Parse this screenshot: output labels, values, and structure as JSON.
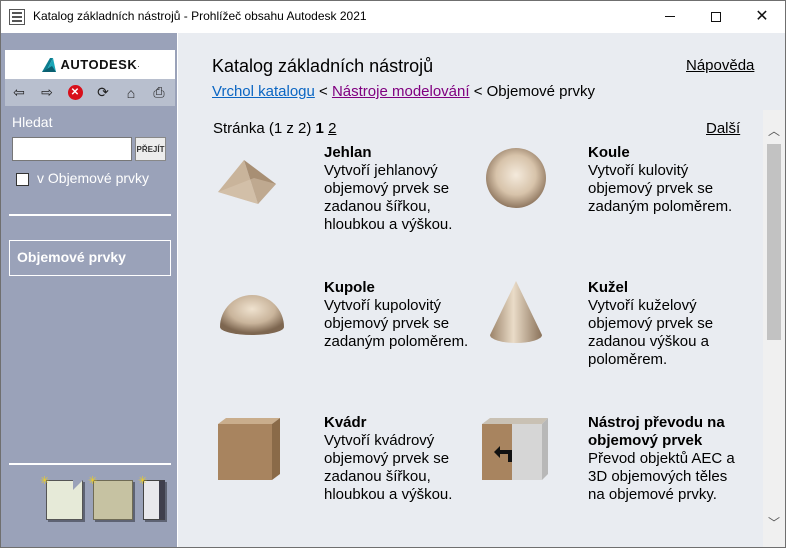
{
  "window": {
    "title": "Katalog základních nástrojů - Prohlížeč obsahu Autodesk 2021",
    "controls": {
      "minimize": "",
      "maximize": "",
      "close": "✕"
    }
  },
  "sidebar": {
    "logo_text": "AUTODESK",
    "logo_dot": ".",
    "nav_icons": [
      {
        "name": "back-icon",
        "glyph": "⇦"
      },
      {
        "name": "forward-icon",
        "glyph": "⇨"
      },
      {
        "name": "stop-icon",
        "glyph": "✕"
      },
      {
        "name": "refresh-icon",
        "glyph": "⟳"
      },
      {
        "name": "home-icon",
        "glyph": "⌂"
      },
      {
        "name": "print-icon",
        "glyph": "⎙"
      }
    ],
    "search_label": "Hledat",
    "search_value": "",
    "go_button": "PŘEJÍT",
    "scope_label": "v Objemové prvky",
    "scope_checked": false,
    "category": "Objemové prvky",
    "palettes": [
      "palette-new-icon",
      "palette-icon",
      "palette-narrow-icon"
    ]
  },
  "header": {
    "title": "Katalog základních nástrojů",
    "help": "Nápověda",
    "breadcrumb": {
      "item1": "Vrchol katalogu",
      "sep1": " < ",
      "item2": "Nástroje modelování",
      "sep2": " < ",
      "current": "Objemové prvky"
    }
  },
  "content": {
    "pager": {
      "label": "Stránka (1 z 2)",
      "current": "1",
      "other": "2"
    },
    "next": "Další",
    "tools": [
      {
        "name": "Jehlan",
        "description": "Vytvoří jehlanový objemový prvek se zadanou šířkou, hloubkou a výškou.",
        "icon": "pyramid-icon"
      },
      {
        "name": "Koule",
        "description": "Vytvoří kulovitý objemový prvek se zadaným poloměrem.",
        "icon": "sphere-icon"
      },
      {
        "name": "Kupole",
        "description": "Vytvoří kupolovitý objemový prvek se zadaným poloměrem.",
        "icon": "dome-icon"
      },
      {
        "name": "Kužel",
        "description": "Vytvoří kuželový objemový prvek se zadanou výškou a poloměrem.",
        "icon": "cone-icon"
      },
      {
        "name": "Kvádr",
        "description": "Vytvoří kvádrový objemový prvek se zadanou šířkou, hloubkou a výškou.",
        "icon": "box-icon"
      },
      {
        "name": "Nástroj převodu na objemový prvek",
        "description": "Převod objektů AEC a 3D objemových těles na objemové prvky.",
        "icon": "convert-to-mass-icon"
      }
    ]
  },
  "colors": {
    "sidebar": "#9aa2b9",
    "content_bg": "#e9ecf1",
    "link": "#0b66c3",
    "visited_link": "#800080",
    "solid_tan": "#c9b49b"
  }
}
